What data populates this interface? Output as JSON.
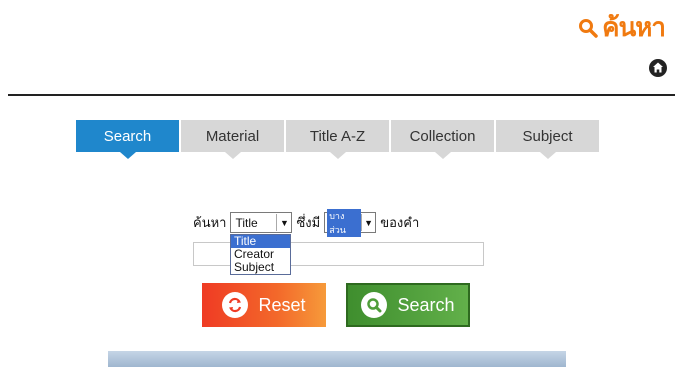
{
  "header": {
    "brand_text": "ค้นหา",
    "brand_color": "#f07a10"
  },
  "tabs": [
    {
      "label": "Search",
      "active": true
    },
    {
      "label": "Material",
      "active": false
    },
    {
      "label": "Title A-Z",
      "active": false
    },
    {
      "label": "Collection",
      "active": false
    },
    {
      "label": "Subject",
      "active": false
    }
  ],
  "search_form": {
    "prefix_label": "ค้นหา",
    "field_select": {
      "value": "Title",
      "options": [
        "Title",
        "Creator",
        "Subject"
      ]
    },
    "middle_label": "ซึ่งมี",
    "match_select": {
      "value": "บางส่วน"
    },
    "suffix_label": "ของคำ",
    "query": {
      "value": "",
      "placeholder": ""
    }
  },
  "buttons": {
    "reset_label": "Reset",
    "search_label": "Search"
  },
  "colors": {
    "tab_active": "#1f87cc",
    "tab_inactive": "#d7d7d7",
    "reset": "#ef3b24",
    "search": "#4f9e3a"
  }
}
